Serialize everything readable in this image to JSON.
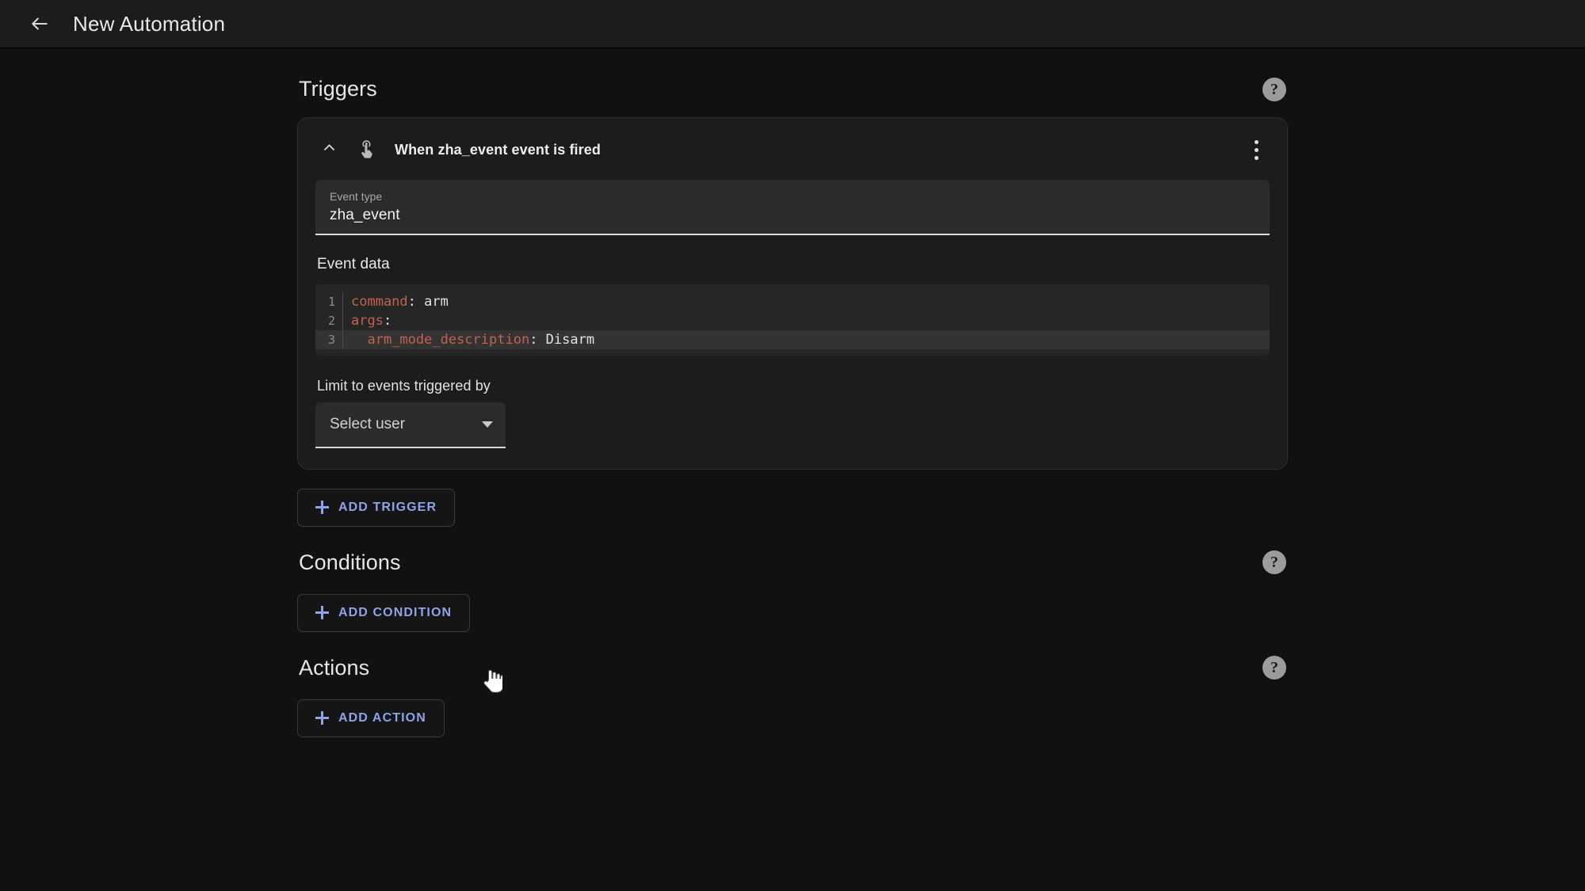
{
  "appbar": {
    "back_icon": "arrow-left-icon",
    "title": "New Automation"
  },
  "sections": {
    "triggers": {
      "title": "Triggers",
      "help_icon": "?",
      "add_button": "ADD TRIGGER"
    },
    "conditions": {
      "title": "Conditions",
      "help_icon": "?",
      "add_button": "ADD CONDITION"
    },
    "actions": {
      "title": "Actions",
      "help_icon": "?",
      "add_button": "ADD ACTION"
    }
  },
  "trigger_card": {
    "title": "When zha_event event is fired",
    "collapse_icon": "chevron-up-icon",
    "type_icon": "gesture-tap-icon",
    "overflow_icon": "dots-vertical-icon",
    "event_type": {
      "label": "Event type",
      "value": "zha_event"
    },
    "event_data": {
      "label": "Event data",
      "lines": [
        {
          "num": "1",
          "key": "command",
          "sep": ": ",
          "value": "arm",
          "indent": "",
          "active": false
        },
        {
          "num": "2",
          "key": "args",
          "sep": ":",
          "value": "",
          "indent": "",
          "active": false
        },
        {
          "num": "3",
          "key": "arm_mode_description",
          "sep": ": ",
          "value": "Disarm",
          "indent": "  ",
          "active": true
        }
      ]
    },
    "limit_users": {
      "label": "Limit to events triggered by",
      "value": "Select user",
      "caret_icon": "caret-down-icon"
    }
  },
  "colors": {
    "page_bg": "#111111",
    "card_bg": "#1c1c1c",
    "field_bg": "#2b2b2b",
    "accent": "#8ea3e8",
    "yaml_key": "#c4614f"
  },
  "cursor": {
    "icon": "pointer-hand-cursor"
  }
}
